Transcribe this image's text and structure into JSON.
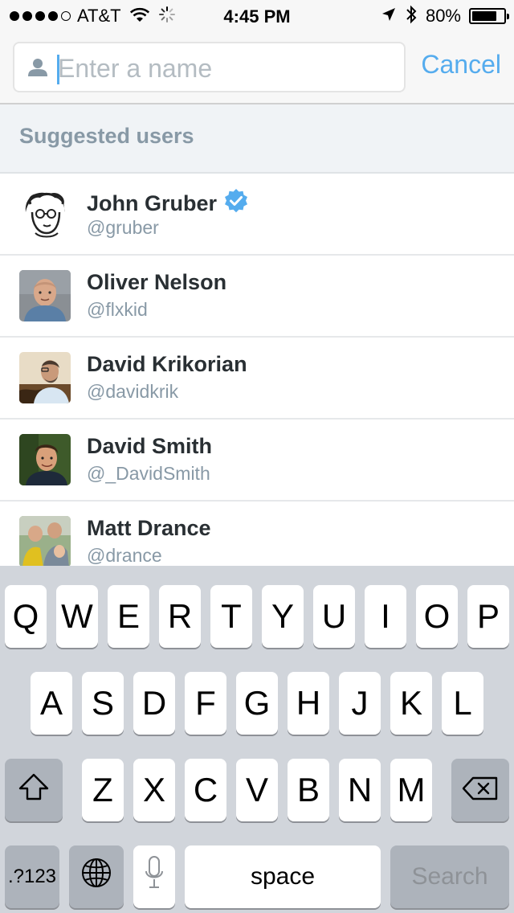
{
  "status_bar": {
    "carrier": "AT&T",
    "time": "4:45 PM",
    "battery_percent": "80%",
    "battery_level": 0.8,
    "signal_bars_filled": 4,
    "signal_bars_total": 5
  },
  "search": {
    "placeholder": "Enter a name",
    "value": "",
    "cancel_label": "Cancel"
  },
  "section": {
    "title": "Suggested users"
  },
  "users": [
    {
      "name": "John Gruber",
      "handle": "@gruber",
      "verified": true
    },
    {
      "name": "Oliver Nelson",
      "handle": "@flxkid",
      "verified": false
    },
    {
      "name": "David Krikorian",
      "handle": "@davidkrik",
      "verified": false
    },
    {
      "name": "David Smith",
      "handle": "@_DavidSmith",
      "verified": false
    },
    {
      "name": "Matt Drance",
      "handle": "@drance",
      "verified": false
    }
  ],
  "keyboard": {
    "row1": [
      "Q",
      "W",
      "E",
      "R",
      "T",
      "Y",
      "U",
      "I",
      "O",
      "P"
    ],
    "row2": [
      "A",
      "S",
      "D",
      "F",
      "G",
      "H",
      "J",
      "K",
      "L"
    ],
    "row3": [
      "Z",
      "X",
      "C",
      "V",
      "B",
      "N",
      "M"
    ],
    "numbers_label": ".?123",
    "space_label": "space",
    "search_label": "Search"
  },
  "colors": {
    "accent": "#55acee",
    "verified": "#55acee",
    "secondary_text": "#8899a6",
    "primary_text": "#292f33",
    "keyboard_bg": "#d1d5db"
  },
  "icons": {
    "person": "person-icon",
    "verified": "verified-badge-icon",
    "wifi": "wifi-icon",
    "location": "location-arrow-icon",
    "bluetooth": "bluetooth-icon",
    "shift": "shift-icon",
    "backspace": "backspace-icon",
    "globe": "globe-icon",
    "microphone": "microphone-icon"
  }
}
